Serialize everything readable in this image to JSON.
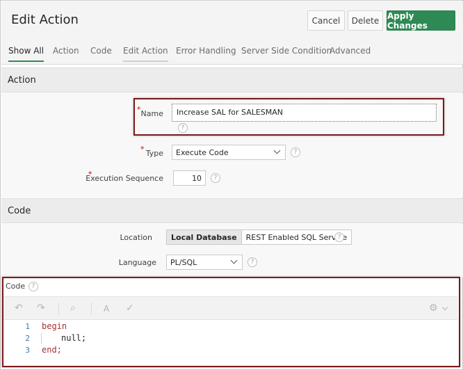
{
  "header": {
    "title": "Edit Action",
    "cancel_label": "Cancel",
    "delete_label": "Delete",
    "apply_label": "Apply Changes"
  },
  "tabs": [
    {
      "label": "Show All"
    },
    {
      "label": "Action"
    },
    {
      "label": "Code"
    },
    {
      "label": "Edit Action"
    },
    {
      "label": "Error Handling"
    },
    {
      "label": "Server Side Condition"
    },
    {
      "label": "Advanced"
    }
  ],
  "action_section": {
    "title": "Action",
    "name_label": "Name",
    "name_value": "Increase SAL for SALESMAN",
    "type_label": "Type",
    "type_value": "Execute Code",
    "seq_label": "Execution Sequence",
    "seq_value": "10",
    "required_mark": "*"
  },
  "code_section": {
    "title": "Code",
    "location_label": "Location",
    "location_options": [
      "Local Database",
      "REST Enabled SQL Service"
    ],
    "language_label": "Language",
    "language_value": "PL/SQL",
    "editor_label": "Code",
    "lines": [
      {
        "num": "1",
        "text": "begin",
        "kind": "keyword"
      },
      {
        "num": "2",
        "text": "null;",
        "kind": "plain"
      },
      {
        "num": "3",
        "text": "end;",
        "kind": "keyword"
      }
    ]
  },
  "icons": {
    "help": "?",
    "undo": "↶",
    "redo": "↷",
    "search": "⌕",
    "format": "A",
    "validate": "✓",
    "settings": "⚙"
  },
  "colors": {
    "accent": "#2e8a55",
    "highlight": "#7d1a1a",
    "keyword": "#a33232",
    "line_number": "#3c6fb0"
  }
}
